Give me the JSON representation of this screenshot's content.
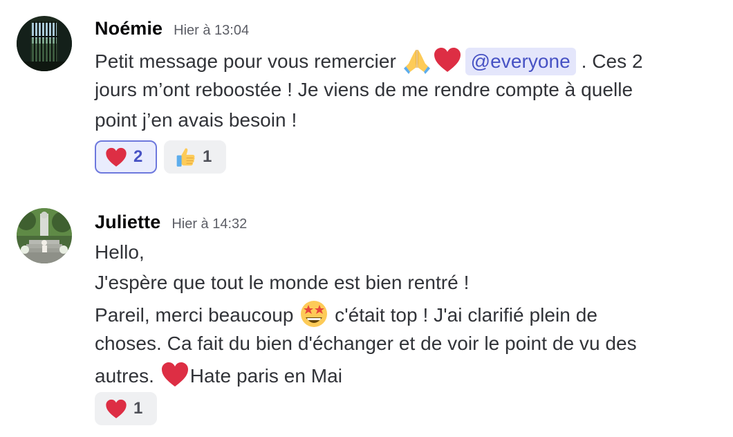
{
  "messages": [
    {
      "username": "Noémie",
      "timestamp": "Hier à 13:04",
      "lines": {
        "l1_text": "Petit message pour vous remercier ",
        "mention": "@everyone",
        "l1_after": " . Ces 2",
        "l2": "jours m’ont reboostée ! Je viens de me rendre compte à quelle",
        "l3": "point j’en avais besoin !"
      },
      "emojis": [
        "folded-hands",
        "red-heart"
      ],
      "reactions": [
        {
          "emoji": "red-heart",
          "count": "2",
          "active": true
        },
        {
          "emoji": "thumbs-up",
          "count": "1",
          "active": false
        }
      ]
    },
    {
      "username": "Juliette",
      "timestamp": "Hier à 14:32",
      "lines": {
        "l1": "Hello,",
        "l2": "J'espère que tout le monde est bien rentré !",
        "l3_before": "Pareil, merci beaucoup ",
        "l3_after": " c'était top ! J'ai clarifié plein de",
        "l4": "choses. Ca fait du bien d'échanger et de voir le point de vu des",
        "l5_before": "autres. ",
        "l5_after": "Hate paris en Mai"
      },
      "emojis": [
        "star-struck",
        "red-heart"
      ],
      "reactions": [
        {
          "emoji": "red-heart",
          "count": "1",
          "active": false
        }
      ]
    }
  ],
  "colors": {
    "mention_bg": "#e4e6fb",
    "mention_text": "#4752c4",
    "reaction_active_border": "#6d78dd",
    "reaction_bg": "#eff0f2",
    "heart": "#dd2e44"
  }
}
